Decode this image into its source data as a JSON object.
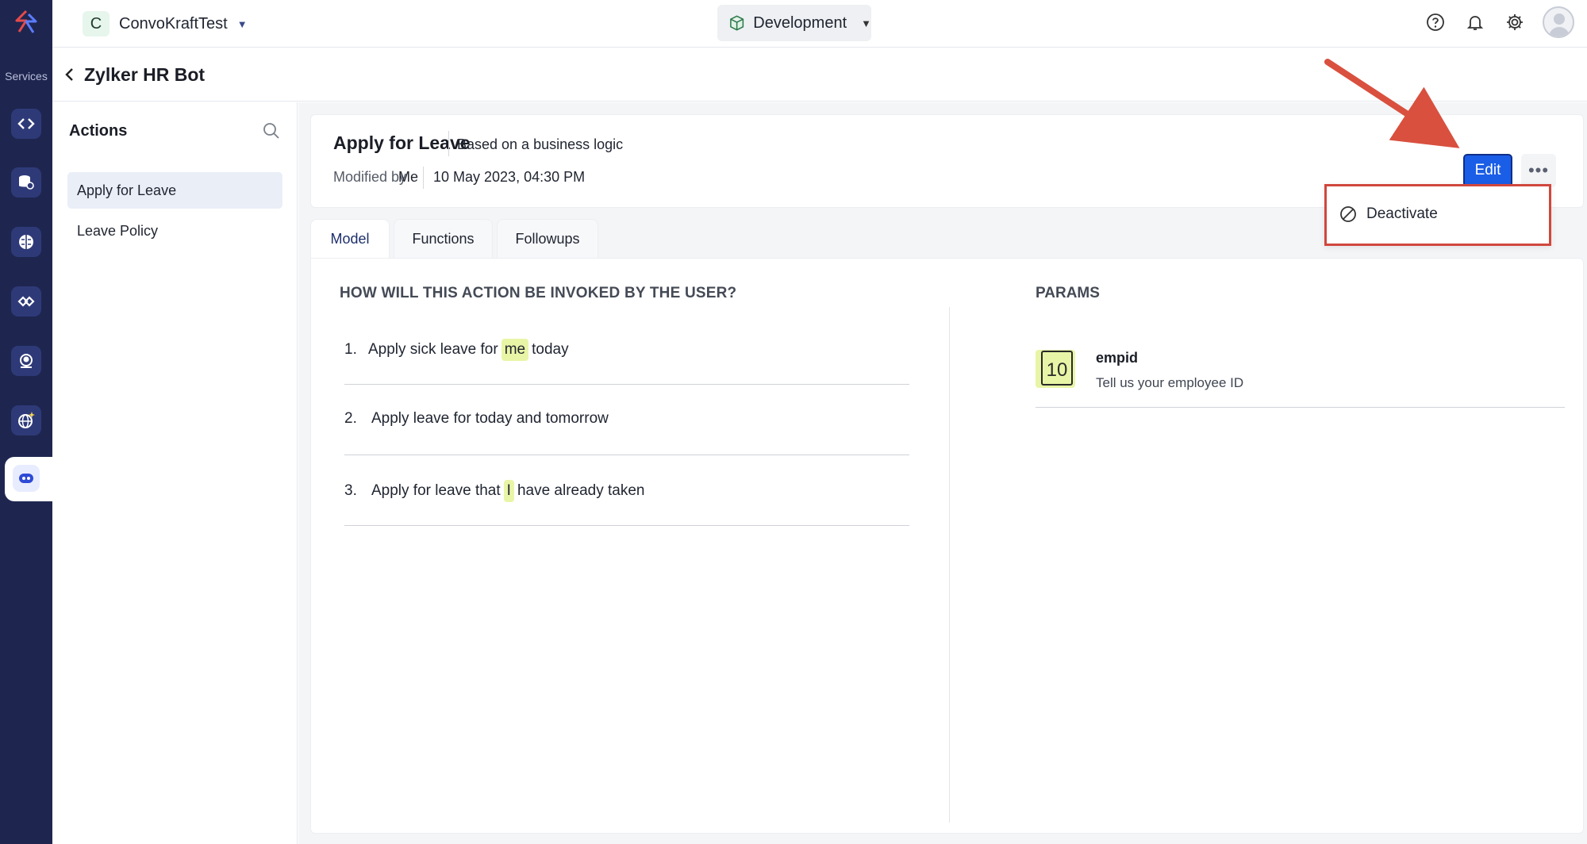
{
  "rail": {
    "services_label": "Services",
    "items": [
      "dev-tools-icon",
      "database-icon",
      "brain-icon",
      "integration-icon",
      "support-agent-icon",
      "globe-sparkle-icon",
      "chat-bot-icon"
    ]
  },
  "topbar": {
    "project_initial": "C",
    "project_name": "ConvoKraftTest",
    "environment": "Development"
  },
  "bot": {
    "title": "Zylker HR Bot"
  },
  "actions": {
    "heading": "Actions",
    "items": [
      {
        "label": "Apply for Leave",
        "active": true
      },
      {
        "label": "Leave Policy",
        "active": false
      }
    ]
  },
  "action": {
    "title": "Apply for Leave",
    "type": "Based on a business logic",
    "modified_label": "Modified by",
    "modified_by": "Me",
    "modified_date": "10 May 2023, 04:30 PM",
    "edit_label": "Edit",
    "more_label": "•••"
  },
  "menu": {
    "deactivate_label": "Deactivate"
  },
  "tabs": [
    {
      "label": "Model",
      "active": true
    },
    {
      "label": "Functions",
      "active": false
    },
    {
      "label": "Followups",
      "active": false
    }
  ],
  "model": {
    "invoke_heading": "HOW WILL THIS ACTION BE INVOKED BY THE USER?",
    "utterances": [
      {
        "num": "1.",
        "before": "Apply sick leave for",
        "highlight": "me",
        "after": "today"
      },
      {
        "num": "2.",
        "before": "Apply leave for today and tomorrow",
        "highlight": "",
        "after": ""
      },
      {
        "num": "3.",
        "before": "Apply for leave that",
        "highlight": "I",
        "after": "have already taken"
      }
    ]
  },
  "params": {
    "heading": "PARAMS",
    "items": [
      {
        "icon_text": "10",
        "name": "empid",
        "description": "Tell us your employee ID"
      }
    ]
  },
  "colors": {
    "rail_bg": "#1e2650",
    "primary": "#1a5de6",
    "highlight": "#e9f5a6",
    "annotation": "#d0473d"
  }
}
